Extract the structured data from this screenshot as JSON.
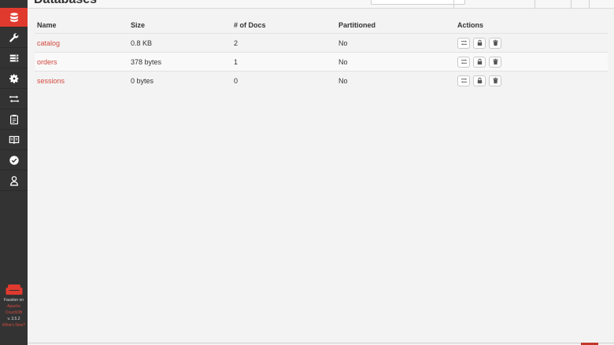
{
  "header": {
    "title": "Databases"
  },
  "sidebar": {
    "items": [
      {
        "name": "databases",
        "icon": "database-icon",
        "active": true
      },
      {
        "name": "setup",
        "icon": "wrench-icon"
      },
      {
        "name": "active-tasks",
        "icon": "tasks-icon"
      },
      {
        "name": "config",
        "icon": "gear-icon"
      },
      {
        "name": "replication",
        "icon": "replication-icon"
      },
      {
        "name": "logs",
        "icon": "clipboard-icon"
      },
      {
        "name": "documentation",
        "icon": "book-icon"
      },
      {
        "name": "verify",
        "icon": "check-circle-icon"
      },
      {
        "name": "user",
        "icon": "user-icon"
      }
    ],
    "brand": {
      "line1": "Fauxton on",
      "line2": "Apache",
      "line3": "CouchDB",
      "version": "v. 3.5.2",
      "whats_new": "What's New?"
    }
  },
  "table": {
    "headers": {
      "name": "Name",
      "size": "Size",
      "docs": "# of Docs",
      "partitioned": "Partitioned",
      "actions": "Actions"
    },
    "rows": [
      {
        "name": "catalog",
        "size": "0.8 KB",
        "docs": "2",
        "partitioned": "No"
      },
      {
        "name": "orders",
        "size": "378 bytes",
        "docs": "1",
        "partitioned": "No"
      },
      {
        "name": "sessions",
        "size": "0 bytes",
        "docs": "0",
        "partitioned": "No"
      }
    ]
  },
  "colors": {
    "accent": "#e03a2f",
    "link": "#d34a40",
    "sidebar": "#333333"
  }
}
